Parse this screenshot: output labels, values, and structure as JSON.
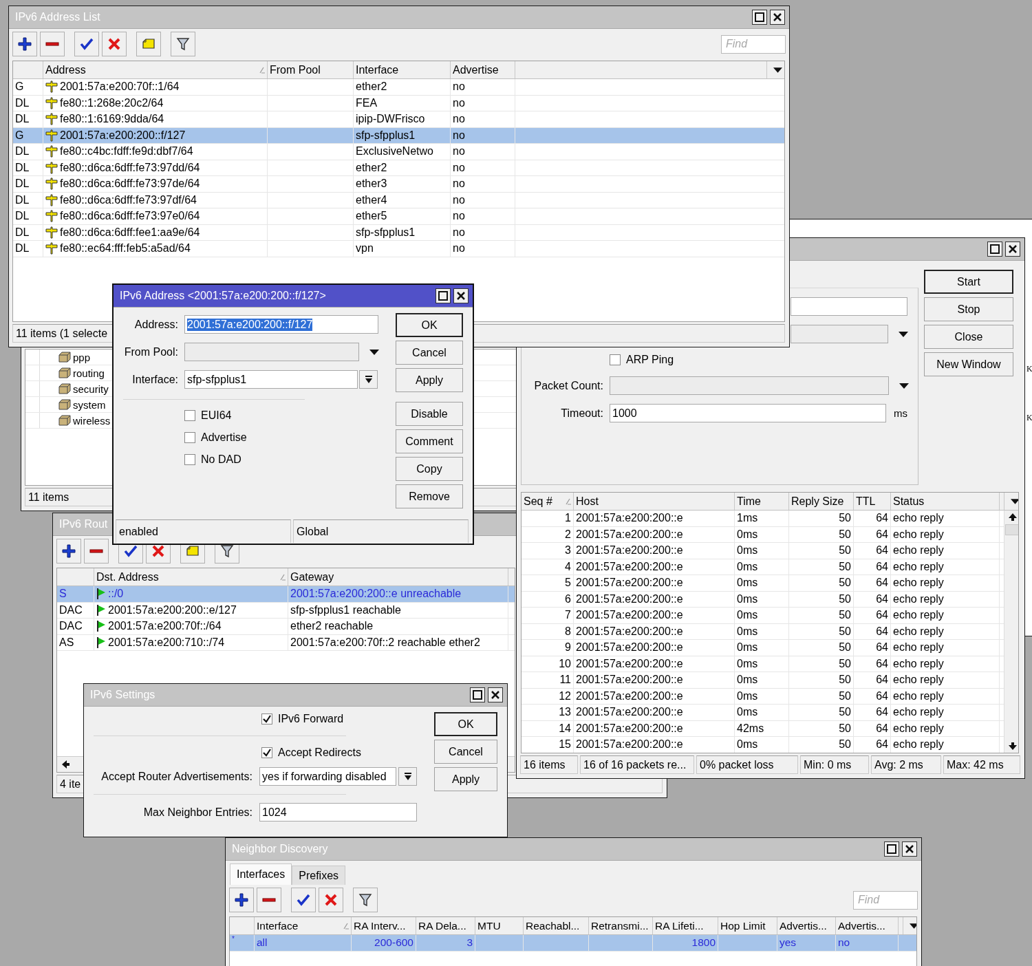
{
  "desktop_window": {
    "letters": [
      "K",
      "K"
    ]
  },
  "packages_window": {
    "items": [
      {
        "name": "ppp"
      },
      {
        "name": "routing"
      },
      {
        "name": "security"
      },
      {
        "name": "system"
      },
      {
        "name": "wireless"
      }
    ],
    "status": "11 items"
  },
  "routes_window": {
    "title": "IPv6 Rout",
    "active": false,
    "columns": [
      {
        "label": "Dst. Address",
        "sorted": true
      },
      {
        "label": "Gateway",
        "sorted": false
      }
    ],
    "rows": [
      {
        "flags": "S",
        "dst_address": "::/0",
        "gateway": "2001:57a:e200:200::e unreachable",
        "selected": true
      },
      {
        "flags": "DAC",
        "dst_address": "2001:57a:e200:200::e/127",
        "gateway": "sfp-sfpplus1 reachable",
        "selected": false
      },
      {
        "flags": "DAC",
        "dst_address": "2001:57a:e200:70f::/64",
        "gateway": "ether2 reachable",
        "selected": false
      },
      {
        "flags": "AS",
        "dst_address": "2001:57a:e200:710::/74",
        "gateway": "2001:57a:e200:70f::2 reachable ether2",
        "selected": false
      }
    ],
    "status": "4 ite"
  },
  "ping_window": {
    "active": false,
    "fields": [
      {
        "kind": "text"
      },
      {
        "kind": "combo"
      },
      {
        "kind": "checkbox",
        "label": "ARP Ping",
        "checked": false
      },
      {
        "kind": "combo",
        "label": "Packet Count:"
      },
      {
        "kind": "text",
        "label": "Timeout:",
        "value": "1000",
        "unit": "ms"
      }
    ],
    "buttons": [
      {
        "label": "Start",
        "default": true
      },
      {
        "label": "Stop",
        "default": false
      },
      {
        "label": "Close",
        "default": false
      },
      {
        "label": "New Window",
        "default": false
      }
    ],
    "columns": [
      {
        "label": "Seq #",
        "sorted": true
      },
      {
        "label": "Host",
        "sorted": false
      },
      {
        "label": "Time",
        "sorted": false
      },
      {
        "label": "Reply Size",
        "sorted": false
      },
      {
        "label": "TTL",
        "sorted": false
      },
      {
        "label": "Status",
        "sorted": false
      }
    ],
    "rows": [
      {
        "seq": "1",
        "host": "2001:57a:e200:200::e",
        "time": "1ms",
        "reply_size": "50",
        "ttl": "64",
        "status": "echo reply",
        "selected": false
      },
      {
        "seq": "2",
        "host": "2001:57a:e200:200::e",
        "time": "0ms",
        "reply_size": "50",
        "ttl": "64",
        "status": "echo reply",
        "selected": false
      },
      {
        "seq": "3",
        "host": "2001:57a:e200:200::e",
        "time": "0ms",
        "reply_size": "50",
        "ttl": "64",
        "status": "echo reply",
        "selected": false
      },
      {
        "seq": "4",
        "host": "2001:57a:e200:200::e",
        "time": "0ms",
        "reply_size": "50",
        "ttl": "64",
        "status": "echo reply",
        "selected": false
      },
      {
        "seq": "5",
        "host": "2001:57a:e200:200::e",
        "time": "0ms",
        "reply_size": "50",
        "ttl": "64",
        "status": "echo reply",
        "selected": false
      },
      {
        "seq": "6",
        "host": "2001:57a:e200:200::e",
        "time": "0ms",
        "reply_size": "50",
        "ttl": "64",
        "status": "echo reply",
        "selected": false
      },
      {
        "seq": "7",
        "host": "2001:57a:e200:200::e",
        "time": "0ms",
        "reply_size": "50",
        "ttl": "64",
        "status": "echo reply",
        "selected": false
      },
      {
        "seq": "8",
        "host": "2001:57a:e200:200::e",
        "time": "0ms",
        "reply_size": "50",
        "ttl": "64",
        "status": "echo reply",
        "selected": false
      },
      {
        "seq": "9",
        "host": "2001:57a:e200:200::e",
        "time": "0ms",
        "reply_size": "50",
        "ttl": "64",
        "status": "echo reply",
        "selected": false
      },
      {
        "seq": "10",
        "host": "2001:57a:e200:200::e",
        "time": "0ms",
        "reply_size": "50",
        "ttl": "64",
        "status": "echo reply",
        "selected": false
      },
      {
        "seq": "11",
        "host": "2001:57a:e200:200::e",
        "time": "0ms",
        "reply_size": "50",
        "ttl": "64",
        "status": "echo reply",
        "selected": false
      },
      {
        "seq": "12",
        "host": "2001:57a:e200:200::e",
        "time": "0ms",
        "reply_size": "50",
        "ttl": "64",
        "status": "echo reply",
        "selected": false
      },
      {
        "seq": "13",
        "host": "2001:57a:e200:200::e",
        "time": "0ms",
        "reply_size": "50",
        "ttl": "64",
        "status": "echo reply",
        "selected": false
      },
      {
        "seq": "14",
        "host": "2001:57a:e200:200::e",
        "time": "42ms",
        "reply_size": "50",
        "ttl": "64",
        "status": "echo reply",
        "selected": false
      },
      {
        "seq": "15",
        "host": "2001:57a:e200:200::e",
        "time": "0ms",
        "reply_size": "50",
        "ttl": "64",
        "status": "echo reply",
        "selected": false
      }
    ],
    "status_bar": [
      "16 items",
      "16 of 16 packets re...",
      "0% packet loss",
      "Min: 0 ms",
      "Avg: 2 ms",
      "Max: 42 ms"
    ]
  },
  "address_list": {
    "title": "IPv6 Address List",
    "active": false,
    "find_placeholder": "Find",
    "columns": [
      {
        "label": "Address",
        "sorted": true
      },
      {
        "label": "From Pool",
        "sorted": false
      },
      {
        "label": "Interface",
        "sorted": false
      },
      {
        "label": "Advertise",
        "sorted": false
      }
    ],
    "rows": [
      {
        "flags": "G",
        "address": "2001:57a:e200:70f::1/64",
        "interface": "ether2",
        "advertise": "no",
        "selected": false
      },
      {
        "flags": "DL",
        "address": "fe80::1:268e:20c2/64",
        "interface": "FEA",
        "advertise": "no",
        "selected": false
      },
      {
        "flags": "DL",
        "address": "fe80::1:6169:9dda/64",
        "interface": "ipip-DWFrisco",
        "advertise": "no",
        "selected": false
      },
      {
        "flags": "G",
        "address": "2001:57a:e200:200::f/127",
        "interface": "sfp-sfpplus1",
        "advertise": "no",
        "selected": true
      },
      {
        "flags": "DL",
        "address": "fe80::c4bc:fdff:fe9d:dbf7/64",
        "interface": "ExclusiveNetwo",
        "advertise": "no",
        "selected": false
      },
      {
        "flags": "DL",
        "address": "fe80::d6ca:6dff:fe73:97dd/64",
        "interface": "ether2",
        "advertise": "no",
        "selected": false
      },
      {
        "flags": "DL",
        "address": "fe80::d6ca:6dff:fe73:97de/64",
        "interface": "ether3",
        "advertise": "no",
        "selected": false
      },
      {
        "flags": "DL",
        "address": "fe80::d6ca:6dff:fe73:97df/64",
        "interface": "ether4",
        "advertise": "no",
        "selected": false
      },
      {
        "flags": "DL",
        "address": "fe80::d6ca:6dff:fe73:97e0/64",
        "interface": "ether5",
        "advertise": "no",
        "selected": false
      },
      {
        "flags": "DL",
        "address": "fe80::d6ca:6dff:fee1:aa9e/64",
        "interface": "sfp-sfpplus1",
        "advertise": "no",
        "selected": false
      },
      {
        "flags": "DL",
        "address": "fe80::ec64:fff:feb5:a5ad/64",
        "interface": "vpn",
        "advertise": "no",
        "selected": false
      }
    ],
    "status": "11 items (1 selecte"
  },
  "address_dialog": {
    "title": "IPv6 Address <2001:57a:e200:200::f/127>",
    "active": true,
    "fields": [
      {
        "kind": "text",
        "label": "Address:",
        "value": "2001:57a:e200:200::f/127",
        "value_selected": true
      },
      {
        "kind": "combo",
        "label": "From Pool:"
      },
      {
        "kind": "select",
        "label": "Interface:",
        "value": "sfp-sfpplus1"
      }
    ],
    "checkboxes": [
      {
        "label": "EUI64",
        "checked": false
      },
      {
        "label": "Advertise",
        "checked": false
      },
      {
        "label": "No DAD",
        "checked": false
      }
    ],
    "buttons": [
      {
        "label": "OK",
        "default": true
      },
      {
        "label": "Cancel",
        "default": false
      },
      {
        "label": "Apply",
        "default": false
      },
      {
        "label": "Disable",
        "default": false
      },
      {
        "label": "Comment",
        "default": false
      },
      {
        "label": "Copy",
        "default": false
      },
      {
        "label": "Remove",
        "default": false
      }
    ],
    "status_bar": [
      "enabled",
      "Global"
    ]
  },
  "settings_window": {
    "title": "IPv6 Settings",
    "active": false,
    "fields": [
      {
        "kind": "checkbox",
        "label": "IPv6 Forward",
        "checked": true
      },
      {
        "kind": "checkbox",
        "label": "Accept Redirects",
        "checked": true
      },
      {
        "kind": "select",
        "label": "Accept Router Advertisements:",
        "value": "yes if forwarding disabled"
      },
      {
        "kind": "text",
        "label": "Max Neighbor Entries:",
        "value": "1024"
      }
    ],
    "buttons": [
      {
        "label": "OK",
        "default": true
      },
      {
        "label": "Cancel",
        "default": false
      },
      {
        "label": "Apply",
        "default": false
      }
    ]
  },
  "neighbor_discovery": {
    "title": "Neighbor Discovery",
    "active": false,
    "tabs": [
      {
        "label": "Interfaces",
        "selected": true
      },
      {
        "label": "Prefixes",
        "selected": false
      }
    ],
    "find_placeholder": "Find",
    "columns": [
      {
        "label": "Interface",
        "sorted": true
      },
      {
        "label": "RA Interv...",
        "sorted": false
      },
      {
        "label": "RA Dela...",
        "sorted": false
      },
      {
        "label": "MTU",
        "sorted": false
      },
      {
        "label": "Reachabl...",
        "sorted": false
      },
      {
        "label": "Retransmi...",
        "sorted": false
      },
      {
        "label": "RA Lifeti...",
        "sorted": false
      },
      {
        "label": "Hop Limit",
        "sorted": false
      },
      {
        "label": "Advertis...",
        "sorted": false
      },
      {
        "label": "Advertis...",
        "sorted": false
      }
    ],
    "rows": [
      {
        "flag": "*",
        "interface": "all",
        "ra_interval": "200-600",
        "ra_delay": "3",
        "ra_lifetime": "1800",
        "column_9": "yes",
        "column_10": "no",
        "selected": true
      }
    ]
  }
}
